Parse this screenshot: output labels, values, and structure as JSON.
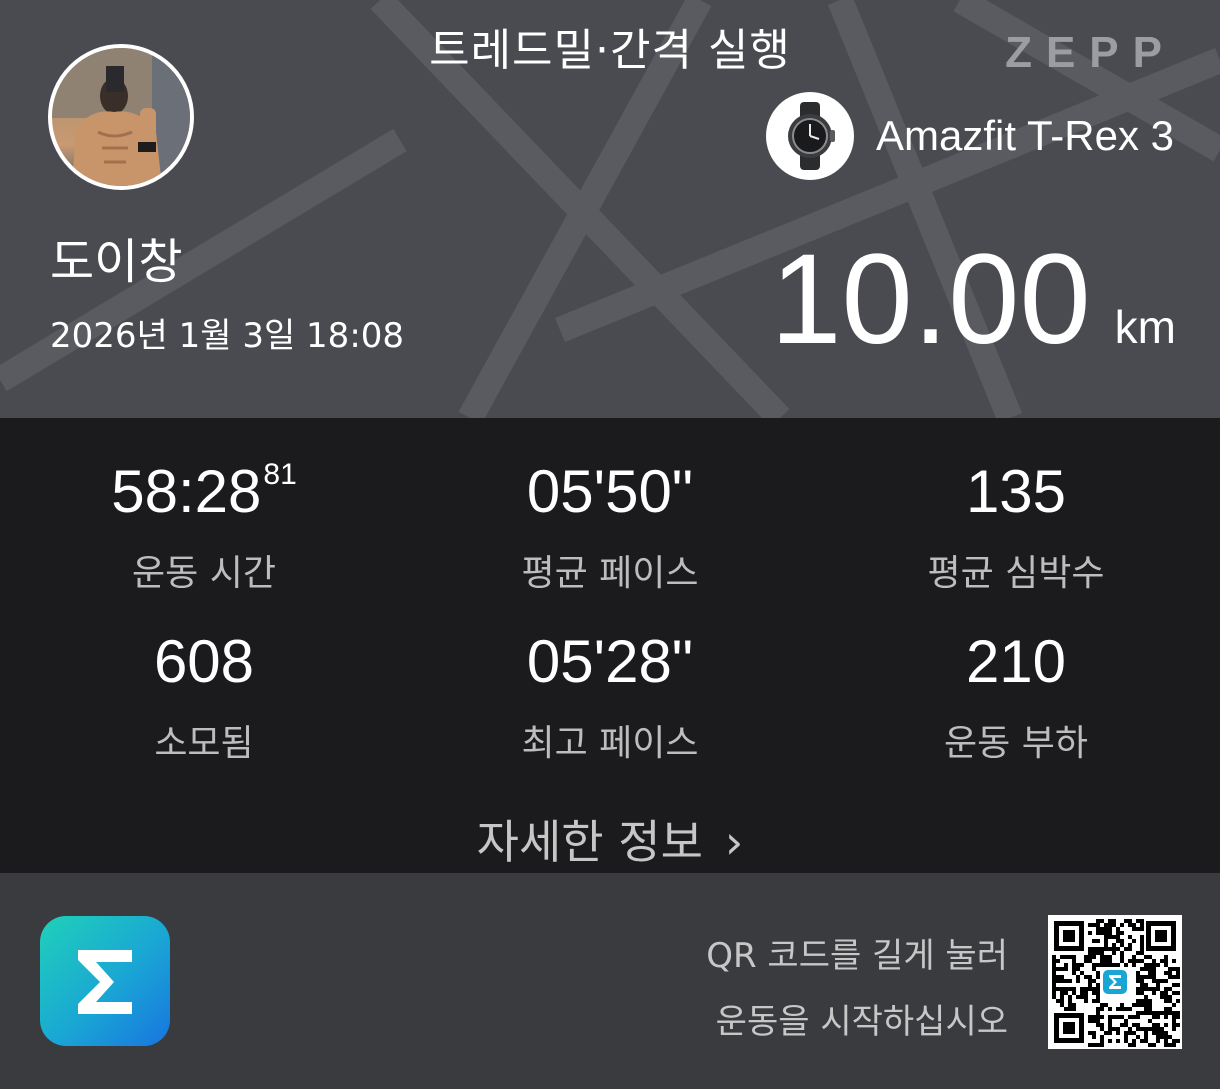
{
  "header": {
    "title": "트레드밀·간격 실행",
    "brand": "ZEPP",
    "user_name": "도이창",
    "datetime": "2026년 1월 3일 18:08",
    "device_name": "Amazfit T-Rex 3",
    "distance_value": "10.00",
    "distance_unit": "km"
  },
  "stats": [
    {
      "value": "58:28",
      "value_sup": "81",
      "label": "운동 시간"
    },
    {
      "value": "05'50\"",
      "label": "평균 페이스"
    },
    {
      "value": "135",
      "label": "평균 심박수"
    },
    {
      "value": "608",
      "label": "소모됨"
    },
    {
      "value": "05'28\"",
      "label": "최고 페이스"
    },
    {
      "value": "210",
      "label": "운동 부하"
    }
  ],
  "details_label": "자세한 정보",
  "details_chevron": "›",
  "footer": {
    "qr_line1": "QR 코드를 길게 눌러",
    "qr_line2": "운동을 시작하십시오"
  },
  "colors": {
    "header_bg": "#4a4b50",
    "stats_bg": "#1b1b1d",
    "footer_bg": "#3a3b3e",
    "logo_gradient_start": "#1fd1b9",
    "logo_gradient_end": "#1875e0"
  },
  "icons": {
    "avatar": "user-avatar-photo",
    "device": "smartwatch-icon",
    "app_logo": "zepp-sigma-logo",
    "qr": "qr-code"
  }
}
